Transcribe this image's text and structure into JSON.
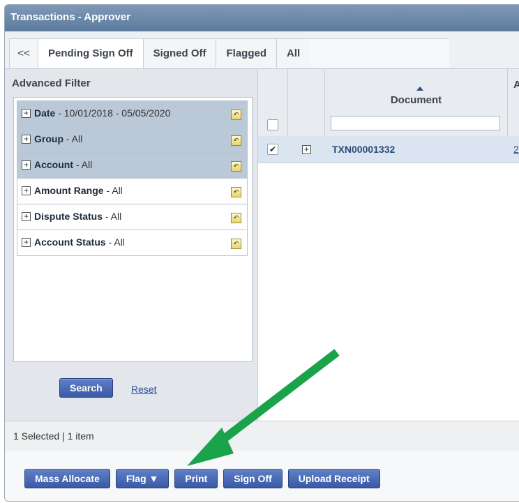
{
  "window": {
    "title": "Transactions - Approver"
  },
  "tabs": [
    {
      "label": "<<"
    },
    {
      "label": "Pending Sign Off"
    },
    {
      "label": "Signed Off"
    },
    {
      "label": "Flagged"
    },
    {
      "label": "All"
    }
  ],
  "advanced_filter": {
    "title": "Advanced Filter",
    "filters": [
      {
        "name": "Date",
        "value": " - 10/01/2018 - 05/05/2020"
      },
      {
        "name": "Group",
        "value": " - All"
      },
      {
        "name": "Account",
        "value": " - All"
      },
      {
        "name": "Amount Range",
        "value": " - All"
      },
      {
        "name": "Dispute Status",
        "value": " - All"
      },
      {
        "name": "Account Status",
        "value": " - All"
      }
    ],
    "search_label": "Search",
    "reset_label": "Reset"
  },
  "grid": {
    "columns": {
      "document": "Document",
      "truncated": "A"
    },
    "rows": [
      {
        "document": "TXN00001332",
        "next_col": "2"
      }
    ]
  },
  "status_text": "1 Selected | 1 item",
  "actions": {
    "mass_allocate": "Mass Allocate",
    "flag": "Flag ▼",
    "print": "Print",
    "sign_off": "Sign Off",
    "upload_receipt": "Upload Receipt"
  },
  "colors": {
    "title_bar": "#6985a8",
    "button": "#3f5fae",
    "arrow": "#1aa34a"
  }
}
